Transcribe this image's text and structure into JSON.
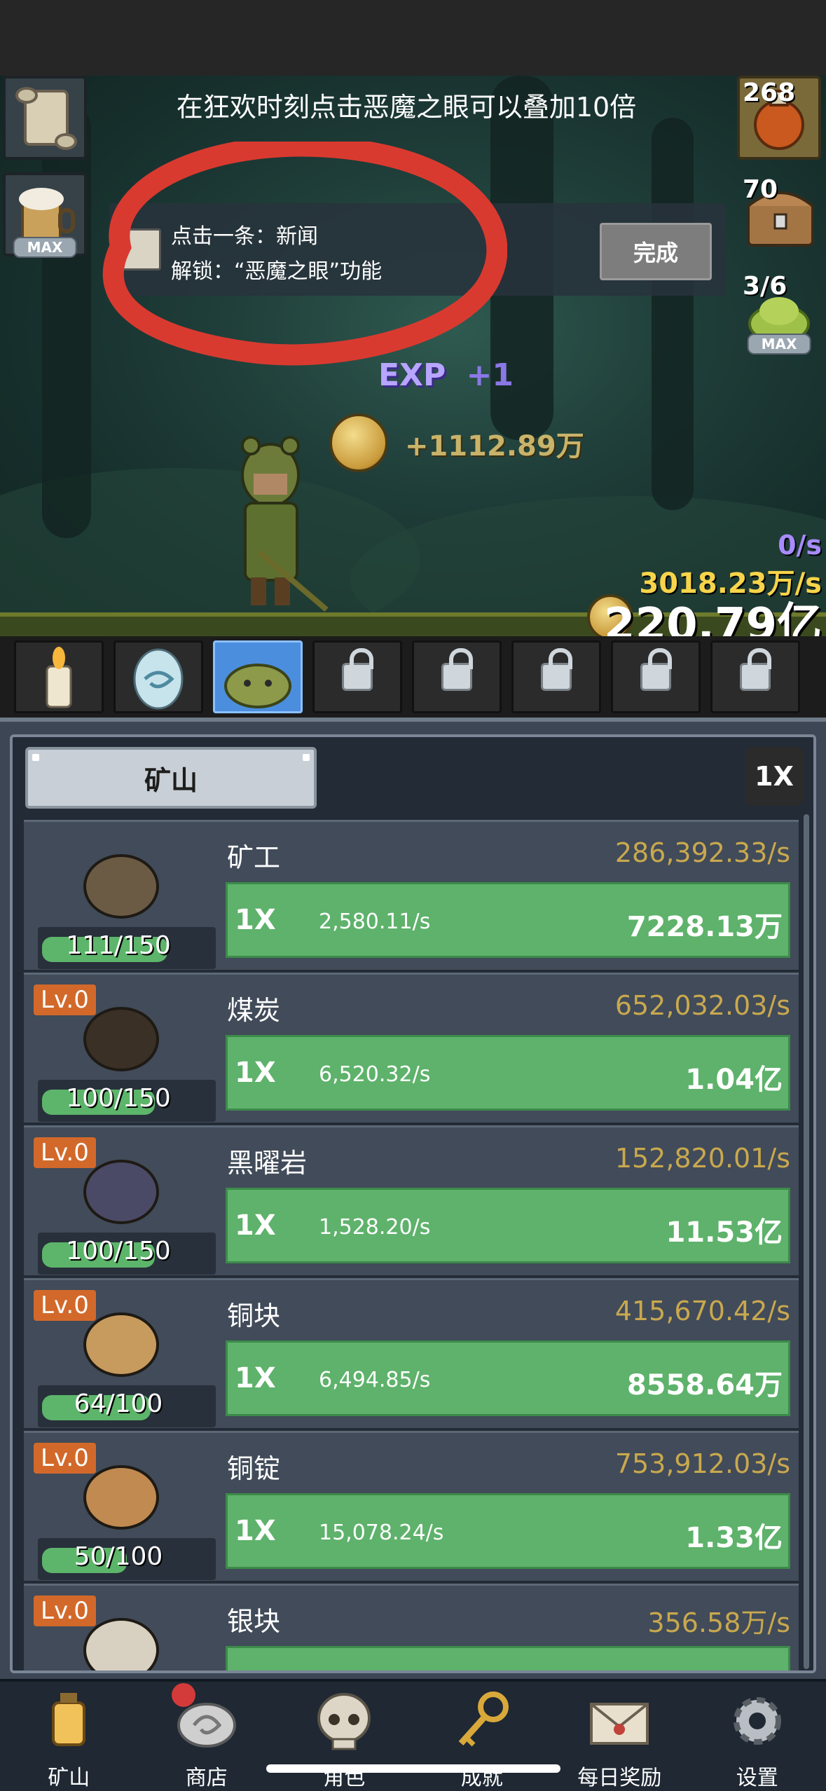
{
  "banner": {
    "tip": "在狂欢时刻点击恶魔之眼可以叠加10倍"
  },
  "side_left": [
    {
      "name": "scroll",
      "tag": ""
    },
    {
      "name": "beer-mug",
      "tag": "MAX"
    }
  ],
  "side_right": [
    {
      "name": "potion",
      "count": "268",
      "tag": ""
    },
    {
      "name": "treasure-chest",
      "count": "70",
      "tag": ""
    },
    {
      "name": "slime-jar",
      "count": "3/6",
      "tag": "MAX"
    }
  ],
  "quest": {
    "line1": "点击一条：新闻",
    "line2": "解锁：“恶魔之眼”功能",
    "button": "完成"
  },
  "floating": {
    "exp_label": "EXP",
    "exp_gain": "+1",
    "coin_gain": "+1112.89万"
  },
  "rates": {
    "exp_per_sec": "0/s",
    "gold_per_sec": "3018.23万/s",
    "total_gold": "220.79亿"
  },
  "characters": [
    {
      "name": "candle",
      "locked": false,
      "active": false
    },
    {
      "name": "egg",
      "locked": false,
      "active": false
    },
    {
      "name": "slime",
      "locked": false,
      "active": true
    },
    {
      "name": "locked-1",
      "locked": true,
      "active": false
    },
    {
      "name": "locked-2",
      "locked": true,
      "active": false
    },
    {
      "name": "locked-3",
      "locked": true,
      "active": false
    },
    {
      "name": "locked-4",
      "locked": true,
      "active": false
    },
    {
      "name": "locked-5",
      "locked": true,
      "active": false
    }
  ],
  "mine": {
    "tab_label": "矿山",
    "multiplier": "1X",
    "rows": [
      {
        "name": "矿工",
        "level": "",
        "progress": "111/150",
        "progress_frac": 0.74,
        "rate": "286,392.33/s",
        "mult": "1X",
        "unit_rate": "2,580.11/s",
        "total": "7228.13万",
        "color": "#6b5b44"
      },
      {
        "name": "煤炭",
        "level": "Lv.0",
        "progress": "100/150",
        "progress_frac": 0.667,
        "rate": "652,032.03/s",
        "mult": "1X",
        "unit_rate": "6,520.32/s",
        "total": "1.04亿",
        "color": "#3b3026"
      },
      {
        "name": "黑曜岩",
        "level": "Lv.0",
        "progress": "100/150",
        "progress_frac": 0.667,
        "rate": "152,820.01/s",
        "mult": "1X",
        "unit_rate": "1,528.20/s",
        "total": "11.53亿",
        "color": "#4a4a66"
      },
      {
        "name": "铜块",
        "level": "Lv.0",
        "progress": "64/100",
        "progress_frac": 0.64,
        "rate": "415,670.42/s",
        "mult": "1X",
        "unit_rate": "6,494.85/s",
        "total": "8558.64万",
        "color": "#c79a5e"
      },
      {
        "name": "铜锭",
        "level": "Lv.0",
        "progress": "50/100",
        "progress_frac": 0.5,
        "rate": "753,912.03/s",
        "mult": "1X",
        "unit_rate": "15,078.24/s",
        "total": "1.33亿",
        "color": "#c08a50"
      },
      {
        "name": "银块",
        "level": "Lv.0",
        "progress": "",
        "progress_frac": 0,
        "rate": "356.58万/s",
        "mult": "",
        "unit_rate": "",
        "total": "",
        "color": "#d8d0c0"
      }
    ]
  },
  "nav": [
    {
      "icon": "lantern-icon",
      "label": "矿山",
      "badge": false
    },
    {
      "icon": "shop-icon",
      "label": "商店",
      "badge": true
    },
    {
      "icon": "skull-icon",
      "label": "角色",
      "badge": false
    },
    {
      "icon": "key-icon",
      "label": "成就",
      "badge": false
    },
    {
      "icon": "envelope-icon",
      "label": "每日奖励",
      "badge": false
    },
    {
      "icon": "gear-icon",
      "label": "设置",
      "badge": false
    }
  ]
}
